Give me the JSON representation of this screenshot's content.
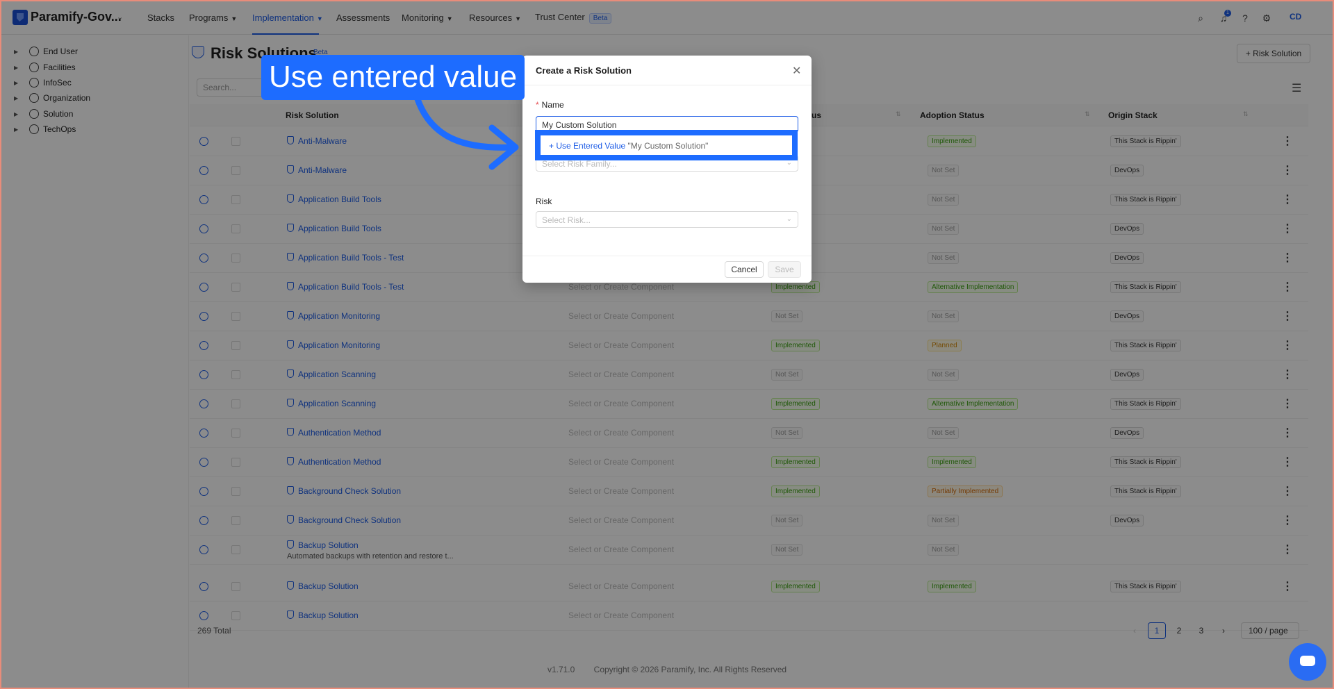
{
  "nav": {
    "org": "Paramify-Gov...",
    "items": [
      "Stacks",
      "Programs",
      "Implementation",
      "Assessments",
      "Monitoring",
      "Resources",
      "Trust Center"
    ],
    "beta": "Beta",
    "notification_count": "1",
    "avatar": "CD"
  },
  "sidebar": {
    "items": [
      "End User",
      "Facilities",
      "InfoSec",
      "Organization",
      "Solution",
      "TechOps"
    ]
  },
  "page": {
    "title": "Risk Solutions",
    "title_badge": "Beta",
    "add_button": "Risk Solution",
    "search_placeholder": "Search..."
  },
  "table": {
    "headers": {
      "name": "Risk Solution",
      "impl": "us",
      "adoption": "Adoption Status",
      "origin": "Origin Stack"
    },
    "component_placeholder": "Select or Create Component",
    "rows": [
      {
        "name": "Anti-Malware",
        "desc": "",
        "impl": "",
        "adopt": "Implemented",
        "adopt_kind": "impl",
        "origin": "This Stack is Rippin'"
      },
      {
        "name": "Anti-Malware",
        "desc": "",
        "impl": "",
        "adopt": "Not Set",
        "adopt_kind": "notset",
        "origin": "DevOps"
      },
      {
        "name": "Application Build Tools",
        "desc": "",
        "impl": "",
        "adopt": "Not Set",
        "adopt_kind": "notset",
        "origin": "This Stack is Rippin'"
      },
      {
        "name": "Application Build Tools",
        "desc": "",
        "impl": "",
        "adopt": "Not Set",
        "adopt_kind": "notset",
        "origin": "DevOps"
      },
      {
        "name": "Application Build Tools - Test",
        "desc": "",
        "impl": "",
        "adopt": "Not Set",
        "adopt_kind": "notset",
        "origin": "DevOps"
      },
      {
        "name": "Application Build Tools - Test",
        "desc": "",
        "impl": "Implemented",
        "impl_kind": "impl",
        "adopt": "Alternative Implementation",
        "adopt_kind": "alt",
        "origin": "This Stack is Rippin'"
      },
      {
        "name": "Application Monitoring",
        "desc": "",
        "impl": "Not Set",
        "impl_kind": "notset",
        "adopt": "Not Set",
        "adopt_kind": "notset",
        "origin": "DevOps"
      },
      {
        "name": "Application Monitoring",
        "desc": "",
        "impl": "Implemented",
        "impl_kind": "impl",
        "adopt": "Planned",
        "adopt_kind": "plan",
        "origin": "This Stack is Rippin'"
      },
      {
        "name": "Application Scanning",
        "desc": "",
        "impl": "Not Set",
        "impl_kind": "notset",
        "adopt": "Not Set",
        "adopt_kind": "notset",
        "origin": "DevOps"
      },
      {
        "name": "Application Scanning",
        "desc": "",
        "impl": "Implemented",
        "impl_kind": "impl",
        "adopt": "Alternative Implementation",
        "adopt_kind": "alt",
        "origin": "This Stack is Rippin'"
      },
      {
        "name": "Authentication Method",
        "desc": "",
        "impl": "Not Set",
        "impl_kind": "notset",
        "adopt": "Not Set",
        "adopt_kind": "notset",
        "origin": "DevOps"
      },
      {
        "name": "Authentication Method",
        "desc": "",
        "impl": "Implemented",
        "impl_kind": "impl",
        "adopt": "Implemented",
        "adopt_kind": "impl",
        "origin": "This Stack is Rippin'"
      },
      {
        "name": "Background Check Solution",
        "desc": "",
        "impl": "Implemented",
        "impl_kind": "impl",
        "adopt": "Partially Implemented",
        "adopt_kind": "part",
        "origin": "This Stack is Rippin'"
      },
      {
        "name": "Background Check Solution",
        "desc": "",
        "impl": "Not Set",
        "impl_kind": "notset",
        "adopt": "Not Set",
        "adopt_kind": "notset",
        "origin": "DevOps"
      },
      {
        "name": "Backup Solution",
        "desc": "Automated backups with retention and restore t...",
        "impl": "Not Set",
        "impl_kind": "notset",
        "adopt": "Not Set",
        "adopt_kind": "notset",
        "origin": ""
      },
      {
        "name": "Backup Solution",
        "desc": "",
        "impl": "Implemented",
        "impl_kind": "impl",
        "adopt": "Implemented",
        "adopt_kind": "impl",
        "origin": "This Stack is Rippin'"
      },
      {
        "name": "Backup Solution",
        "desc": "",
        "impl": "",
        "adopt": "",
        "origin": ""
      }
    ]
  },
  "pagination": {
    "total": "269 Total",
    "pages": [
      "1",
      "2",
      "3"
    ],
    "per_page": "100 / page"
  },
  "footer": {
    "version": "v1.71.0",
    "copyright": "Copyright © 2026 Paramify, Inc. All Rights Reserved"
  },
  "modal": {
    "title": "Create a Risk Solution",
    "name_label": "Name",
    "name_value": "My Custom Solution",
    "family_placeholder": "Select Risk Family...",
    "risk_label": "Risk",
    "risk_placeholder": "Select Risk...",
    "cancel": "Cancel",
    "save": "Save"
  },
  "dropdown": {
    "option_label": "Use Entered Value",
    "option_value": "\"My Custom Solution\""
  },
  "callout": {
    "text": "Use entered value"
  },
  "colors": {
    "accent": "#1d5ce6",
    "callout": "#1d6cff"
  }
}
